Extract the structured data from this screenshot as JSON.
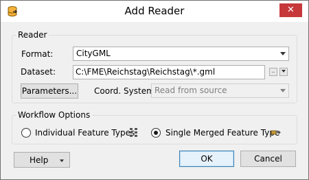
{
  "window": {
    "title": "Add Reader",
    "close_label": "✕"
  },
  "reader": {
    "legend": "Reader",
    "format": {
      "label": "Format:",
      "value": "CityGML"
    },
    "dataset": {
      "label": "Dataset:",
      "value": "C:\\FME\\Reichstag\\Reichstag\\*.gml"
    },
    "parameters_label": "Parameters...",
    "coord_system": {
      "label": "Coord. System:",
      "value": "Read from source"
    }
  },
  "workflow": {
    "legend": "Workflow Options",
    "individual_label": "Individual Feature Types",
    "single_label": "Single Merged Feature Type",
    "selected": "single"
  },
  "footer": {
    "help_label": "Help",
    "ok_label": "OK",
    "cancel_label": "Cancel"
  },
  "icons": {
    "app": "fme-reader-icon",
    "individual": "feature-types-icon",
    "single": "merged-feature-type-icon"
  }
}
